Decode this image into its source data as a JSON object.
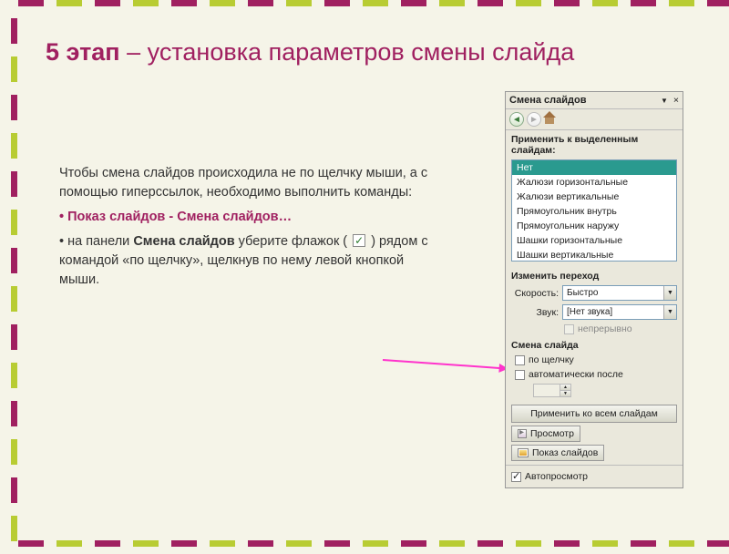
{
  "title": {
    "bold": "5 этап",
    "rest": " – установка параметров смены слайда"
  },
  "body": {
    "p1": "Чтобы смена слайдов происходила не по щелчку мыши, а с помощью гиперссылок, необходимо выполнить команды:",
    "b1": "• Показ слайдов - Смена слайдов…",
    "p2a": "• на панели ",
    "p2bold": "Смена слайдов",
    "p2b": " уберите флажок ( ",
    "p2c": " ) рядом с командой «по щелчку», щелкнув по нему левой кнопкой мыши."
  },
  "panel": {
    "title": "Смена слайдов",
    "section1": "Применить к выделенным слайдам:",
    "list": [
      "Нет",
      "Жалюзи горизонтальные",
      "Жалюзи вертикальные",
      "Прямоугольник внутрь",
      "Прямоугольник наружу",
      "Шашки горизонтальные",
      "Шашки вертикальные"
    ],
    "section2": "Изменить переход",
    "speed_label": "Скорость:",
    "speed_value": "Быстро",
    "sound_label": "Звук:",
    "sound_value": "[Нет звука]",
    "loop_label": "непрерывно",
    "section3": "Смена слайда",
    "on_click": "по щелчку",
    "auto_after": "автоматически после",
    "apply_all": "Применить ко всем слайдам",
    "preview": "Просмотр",
    "slideshow": "Показ слайдов",
    "autopreview": "Автопросмотр"
  }
}
